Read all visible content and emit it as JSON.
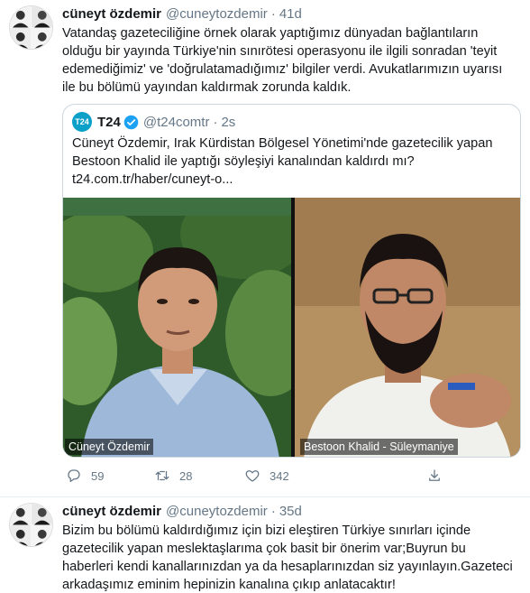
{
  "tweets": [
    {
      "author_name": "cüneyt özdemir",
      "author_handle": "@cuneytozdemir",
      "separator": "·",
      "time": "41d",
      "text_lines": [
        "Vatandaş gazeteciliğine örnek olarak yaptığımız dünyadan  bağlantıların",
        "olduğu bir yayında Türkiye'nin sınırötesi operasyonu ile ilgili sonradan 'teyit",
        "edemediğimiz' ve 'doğrulatamadığımız' bilgiler verdi. Avukatlarımızın uyarısı",
        "ile bu bölümü yayından kaldırmak zorunda kaldık."
      ],
      "quoted": {
        "logo_text": "T24",
        "author_name": "T24",
        "author_handle": "@t24comtr",
        "separator": "·",
        "time": "2s",
        "text_lines": [
          "Cüneyt Özdemir, Irak Kürdistan Bölgesel Yönetimi'nde gazetecilik yapan",
          "Bestoon Khalid ile yaptığı söyleşiyi kanalından kaldırdı mı?",
          "t24.com.tr/haber/cuneyt-o..."
        ],
        "media": {
          "left_caption": "Cüneyt Özdemir",
          "right_caption": "Bestoon Khalid - Süleymaniye"
        }
      },
      "actions": {
        "reply_count": "59",
        "retweet_count": "28",
        "like_count": "342",
        "icons": [
          "reply-icon",
          "retweet-icon",
          "like-icon",
          "share-icon"
        ]
      }
    },
    {
      "author_name": "cüneyt özdemir",
      "author_handle": "@cuneytozdemir",
      "separator": "·",
      "time": "35d",
      "text_lines": [
        "Bizim bu bölümü kaldırdığımız için bizi eleştiren Türkiye sınırları içinde",
        "gazetecilik yapan meslektaşlarıma çok basit bir önerim var;Buyrun bu",
        "haberleri kendi kanallarınızdan  ya da hesaplarınızdan siz yayınlayın.Gazeteci",
        "arkadaşımız eminim hepinizin kanalına çıkıp anlatacaktır!"
      ]
    }
  ],
  "colors": {
    "text": "#14171a",
    "muted": "#657786",
    "verified": "#1da1f2",
    "border": "#e6ecf0",
    "t24_logo": "#0aa0c8"
  }
}
